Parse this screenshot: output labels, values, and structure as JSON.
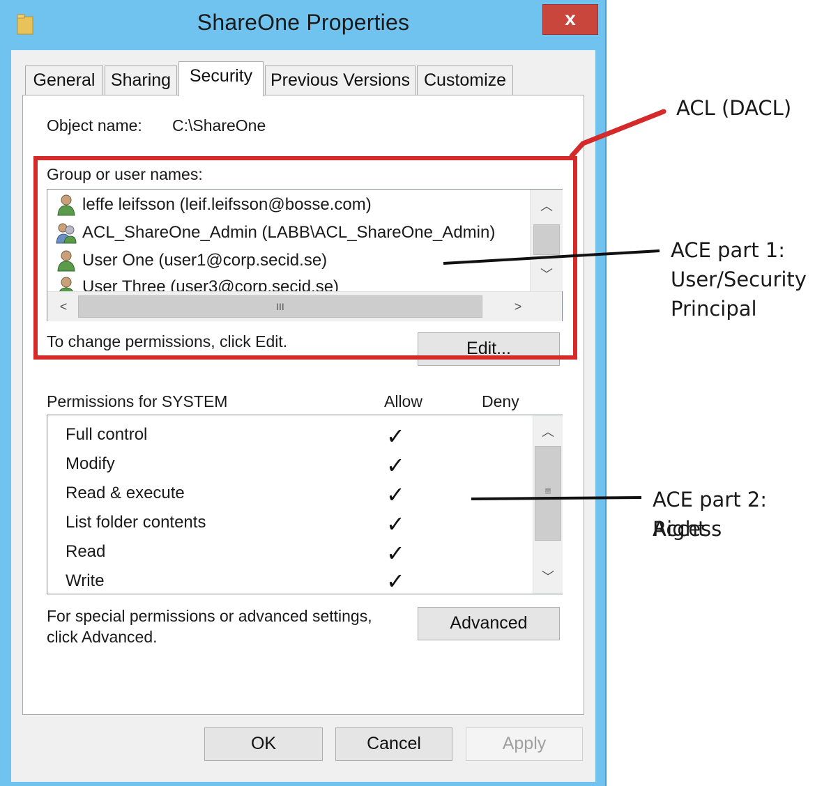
{
  "window": {
    "title": "ShareOne Properties",
    "close_label": "x",
    "folder_icon": "folder-icon",
    "close_icon": "close-icon"
  },
  "tabs": [
    {
      "label": "General",
      "active": false
    },
    {
      "label": "Sharing",
      "active": false
    },
    {
      "label": "Security",
      "active": true
    },
    {
      "label": "Previous Versions",
      "active": false
    },
    {
      "label": "Customize",
      "active": false
    }
  ],
  "security": {
    "object_name_label": "Object name:",
    "object_name_value": "C:\\ShareOne",
    "group_label": "Group or user names:",
    "users": [
      {
        "name": "leffe leifsson (leif.leifsson@bosse.com)",
        "icon": "user-icon"
      },
      {
        "name": "ACL_ShareOne_Admin (LABB\\ACL_ShareOne_Admin)",
        "icon": "group-icon"
      },
      {
        "name": "User One (user1@corp.secid.se)",
        "icon": "user-icon"
      },
      {
        "name": "User Three (user3@corp.secid.se)",
        "icon": "user-icon"
      }
    ],
    "hscroll_grip": "III",
    "change_hint": "To change permissions, click Edit.",
    "edit_label": "Edit...",
    "permissions_label": "Permissions for SYSTEM",
    "allow_header": "Allow",
    "deny_header": "Deny",
    "permissions": [
      {
        "name": "Full control",
        "allow": true,
        "deny": false
      },
      {
        "name": "Modify",
        "allow": true,
        "deny": false
      },
      {
        "name": "Read & execute",
        "allow": true,
        "deny": false
      },
      {
        "name": "List folder contents",
        "allow": true,
        "deny": false
      },
      {
        "name": "Read",
        "allow": true,
        "deny": false
      },
      {
        "name": "Write",
        "allow": true,
        "deny": false
      }
    ],
    "check_glyph": "✓",
    "advanced_hint_1": "For special permissions or advanced settings,",
    "advanced_hint_2": "click Advanced.",
    "advanced_label": "Advanced"
  },
  "footer": {
    "ok_label": "OK",
    "cancel_label": "Cancel",
    "apply_label": "Apply",
    "apply_enabled": false
  },
  "annotations": {
    "acl": "ACL (DACL)",
    "ace1_line1": "ACE part 1:",
    "ace1_line2": "User/Security",
    "ace1_line3": "Principal",
    "ace2_line1": "ACE part 2: Access",
    "ace2_line2": "Right",
    "highlight_color": "#d42a2a"
  }
}
